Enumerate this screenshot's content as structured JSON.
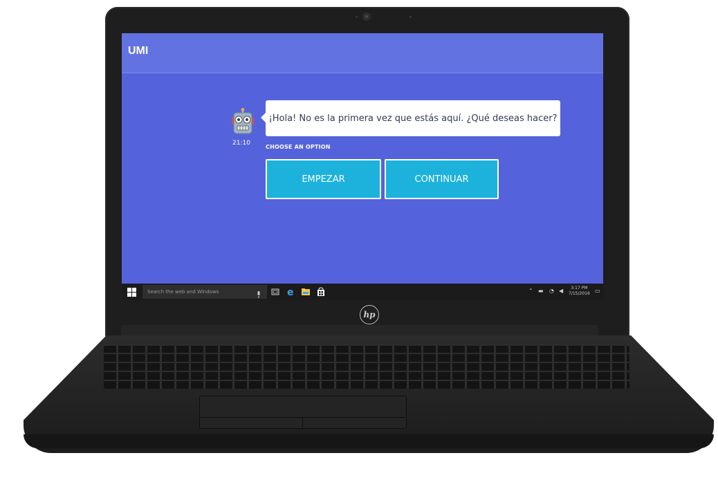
{
  "app": {
    "title": "UMI"
  },
  "chat": {
    "message": "¡Hola! No es la primera vez que estás aquí. ¿Qué deseas hacer?",
    "time": "21:10",
    "choose_label": "CHOOSE AN OPTION",
    "options": [
      "EMPEZAR",
      "CONTINUAR"
    ]
  },
  "taskbar": {
    "search_placeholder": "Search the web and Windows",
    "clock_time": "3:17 PM",
    "clock_date": "7/15/2016"
  },
  "colors": {
    "screen_bg": "#5463db",
    "header_bg": "#6272e0",
    "button_bg": "#1cb2db",
    "laptop_body": "#1e1e1e"
  },
  "icons": [
    "robot-icon",
    "windows-start-icon",
    "microphone-icon",
    "task-view-icon",
    "edge-icon",
    "file-explorer-icon",
    "store-icon",
    "chevron-up-icon",
    "battery-icon",
    "network-icon",
    "volume-icon",
    "action-center-icon",
    "hp-logo-icon",
    "camera-icon"
  ]
}
